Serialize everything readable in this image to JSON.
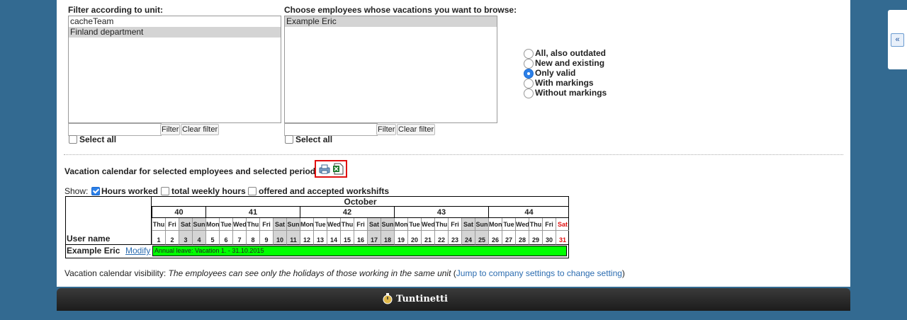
{
  "unit_filter": {
    "label": "Filter according to unit:",
    "options": [
      "cacheTeam",
      "Finland department"
    ],
    "selected_index": 1,
    "filter_button": "Filter",
    "clear_button": "Clear filter",
    "select_all": "Select all"
  },
  "employee_filter": {
    "label": "Choose employees whose vacations you want to browse:",
    "options": [
      "Example Eric"
    ],
    "selected_index": 0,
    "filter_button": "Filter",
    "clear_button": "Clear filter",
    "select_all": "Select all"
  },
  "validity": {
    "options": [
      "All, also outdated",
      "New and existing",
      "Only valid",
      "With markings",
      "Without markings"
    ],
    "selected_index": 2
  },
  "calendar_heading": "Vacation calendar for selected employees and selected period",
  "show_options": {
    "label": "Show:",
    "hours_worked": "Hours worked",
    "weekly_hours": "total weekly hours",
    "workshifts": "offered and accepted workshifts",
    "hours_worked_checked": true
  },
  "calendar": {
    "month": "October",
    "user_col_label": "User name",
    "weeks": [
      {
        "num": "40",
        "days": 4
      },
      {
        "num": "41",
        "days": 7
      },
      {
        "num": "42",
        "days": 7
      },
      {
        "num": "43",
        "days": 7
      },
      {
        "num": "44",
        "days": 6
      }
    ],
    "days": [
      {
        "wd": "Thu",
        "d": "1"
      },
      {
        "wd": "Fri",
        "d": "2"
      },
      {
        "wd": "Sat",
        "d": "3",
        "we": true
      },
      {
        "wd": "Sun",
        "d": "4",
        "we": true
      },
      {
        "wd": "Mon",
        "d": "5"
      },
      {
        "wd": "Tue",
        "d": "6"
      },
      {
        "wd": "Wed",
        "d": "7"
      },
      {
        "wd": "Thu",
        "d": "8"
      },
      {
        "wd": "Fri",
        "d": "9"
      },
      {
        "wd": "Sat",
        "d": "10",
        "we": true
      },
      {
        "wd": "Sun",
        "d": "11",
        "we": true
      },
      {
        "wd": "Mon",
        "d": "12"
      },
      {
        "wd": "Tue",
        "d": "13"
      },
      {
        "wd": "Wed",
        "d": "14"
      },
      {
        "wd": "Thu",
        "d": "15"
      },
      {
        "wd": "Fri",
        "d": "16"
      },
      {
        "wd": "Sat",
        "d": "17",
        "we": true
      },
      {
        "wd": "Sun",
        "d": "18",
        "we": true
      },
      {
        "wd": "Mon",
        "d": "19"
      },
      {
        "wd": "Tue",
        "d": "20"
      },
      {
        "wd": "Wed",
        "d": "21"
      },
      {
        "wd": "Thu",
        "d": "22"
      },
      {
        "wd": "Fri",
        "d": "23"
      },
      {
        "wd": "Sat",
        "d": "24",
        "we": true
      },
      {
        "wd": "Sun",
        "d": "25",
        "we": true
      },
      {
        "wd": "Mon",
        "d": "26"
      },
      {
        "wd": "Tue",
        "d": "27"
      },
      {
        "wd": "Wed",
        "d": "28"
      },
      {
        "wd": "Thu",
        "d": "29"
      },
      {
        "wd": "Fri",
        "d": "30"
      },
      {
        "wd": "Sat",
        "d": "31",
        "red": true
      }
    ],
    "rows": [
      {
        "name": "Example Eric",
        "modify": "Modify",
        "vacation": "Annual leave: Vacation 1. - 31.10.2015"
      }
    ],
    "vacation_color": "#00ff00",
    "weekend_color": "#d4d4d4",
    "highlight_color": "#e01010"
  },
  "visibility": {
    "prefix": "Vacation calendar visibility:",
    "text": "The employees can see only the holidays of those working in the same unit",
    "open_paren": "(",
    "link": "Jump to company settings to change setting",
    "close_paren": ")"
  },
  "footer": {
    "brand": "Tuntinetti"
  },
  "side_tab": {
    "glyph": "«"
  },
  "colors": {
    "background": "#336a91",
    "link": "#2b6cb0",
    "accent": "#2c80e8"
  }
}
